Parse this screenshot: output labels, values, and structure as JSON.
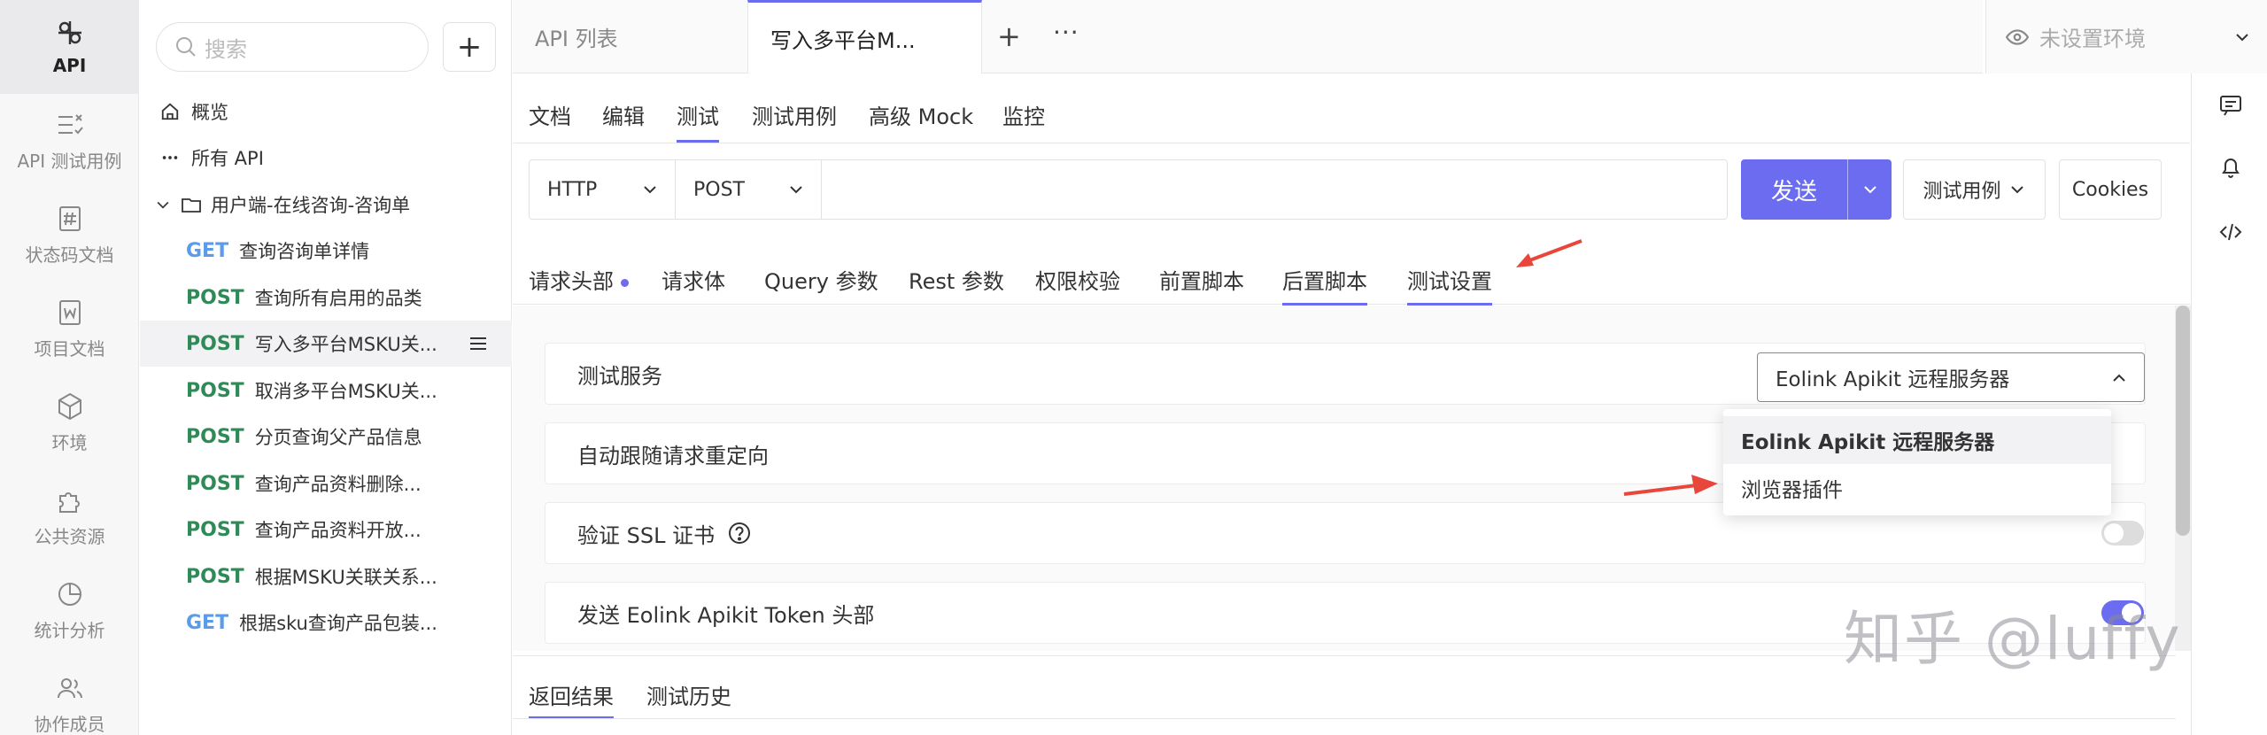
{
  "leftnav": {
    "items": [
      {
        "label": "API",
        "icon": "api-icon"
      },
      {
        "label": "API 测试用例",
        "icon": "test-case-icon"
      },
      {
        "label": "状态码文档",
        "icon": "status-code-icon"
      },
      {
        "label": "项目文档",
        "icon": "project-doc-icon"
      },
      {
        "label": "环境",
        "icon": "environment-icon"
      },
      {
        "label": "公共资源",
        "icon": "puzzle-icon"
      },
      {
        "label": "统计分析",
        "icon": "pie-chart-icon"
      },
      {
        "label": "协作成员",
        "icon": "members-icon"
      }
    ]
  },
  "tree": {
    "search_placeholder": "搜索",
    "add_label": "+",
    "overview": "概览",
    "all_api": "所有 API",
    "group": "用户端-在线咨询-咨询单",
    "apis": [
      {
        "method": "GET",
        "name": "查询咨询单详情"
      },
      {
        "method": "POST",
        "name": "查询所有启用的品类"
      },
      {
        "method": "POST",
        "name": "写入多平台MSKU关..."
      },
      {
        "method": "POST",
        "name": "取消多平台MSKU关..."
      },
      {
        "method": "POST",
        "name": "分页查询父产品信息"
      },
      {
        "method": "POST",
        "name": "查询产品资料删除..."
      },
      {
        "method": "POST",
        "name": "查询产品资料开放..."
      },
      {
        "method": "POST",
        "name": "根据MSKU关联关系..."
      },
      {
        "method": "GET",
        "name": "根据sku查询产品包装..."
      }
    ]
  },
  "toptabs": {
    "tabs": [
      "API 列表",
      "写入多平台M..."
    ],
    "plus": "+",
    "more": "···",
    "env_label": "未设置环境"
  },
  "subtabs": [
    "文档",
    "编辑",
    "测试",
    "测试用例",
    "高级 Mock",
    "监控"
  ],
  "urlbar": {
    "protocol": "HTTP",
    "method": "POST",
    "send": "发送",
    "test_case": "测试用例",
    "cookies": "Cookies"
  },
  "reqtabs": [
    "请求头部",
    "请求体",
    "Query 参数",
    "Rest 参数",
    "权限校验",
    "前置脚本",
    "后置脚本",
    "测试设置"
  ],
  "settings": {
    "service_label": "测试服务",
    "service_value": "Eolink Apikit 远程服务器",
    "redirect_label": "自动跟随请求重定向",
    "ssl_label": "验证 SSL 证书",
    "ssl_enabled": false,
    "token_label": "发送 Eolink Apikit Token 头部",
    "token_enabled": true
  },
  "dropdown": {
    "options": [
      "Eolink Apikit 远程服务器",
      "浏览器插件"
    ]
  },
  "resptabs": [
    "返回结果",
    "测试历史"
  ],
  "watermark": "知乎 @luffy",
  "colors": {
    "accent": "#6b6cf0",
    "get": "#5a9bea",
    "post": "#2e8b57",
    "arrow": "#e8463a"
  }
}
